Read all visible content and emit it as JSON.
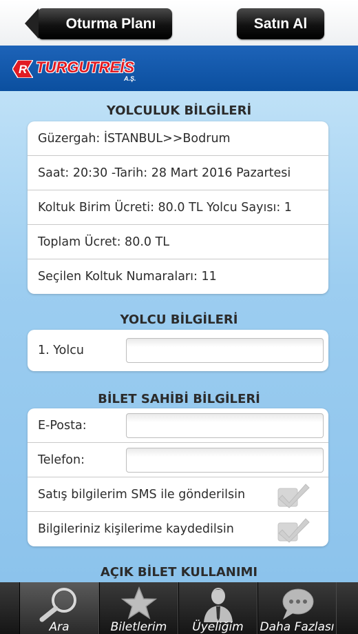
{
  "header": {
    "back_label": "Oturma Planı",
    "buy_label": "Satın Al"
  },
  "brand": {
    "logo_text": "TURGUTREİS",
    "logo_sub": "A.Ş."
  },
  "trip": {
    "title": "YOLCULUK BİLGİLERİ",
    "rows": [
      "Güzergah: İSTANBUL>>Bodrum",
      "Saat: 20:30 -Tarih: 28 Mart 2016 Pazartesi",
      "Koltuk Birim Ücreti: 80.0 TL  Yolcu Sayısı: 1",
      "Toplam Ücret: 80.0 TL",
      "Seçilen Koltuk Numaraları: 11"
    ]
  },
  "passenger": {
    "title": "YOLCU BİLGİLERİ",
    "label": "1. Yolcu",
    "value": ""
  },
  "owner": {
    "title": "BİLET SAHİBİ BİLGİLERİ",
    "email_label": "E-Posta:",
    "email_value": "",
    "phone_label": "Telefon:",
    "phone_value": "",
    "sms_label": "Satış bilgilerim SMS ile gönderilsin",
    "save_label": "Bilgileriniz kişilerime kaydedilsin"
  },
  "open_ticket": {
    "title": "AÇIK BİLET KULLANIMI"
  },
  "nav": {
    "tabs": [
      {
        "label": "Ara",
        "icon": "magnifier-icon"
      },
      {
        "label": "Biletlerim",
        "icon": "star-icon"
      },
      {
        "label": "Üyeliğim",
        "icon": "user-icon"
      },
      {
        "label": "Daha Fazlası",
        "icon": "chat-bubble-icon"
      }
    ],
    "active": "Ara"
  },
  "colors": {
    "brand_blue": "#0b4f9f",
    "brand_red": "#e21b22",
    "content_bg": "#9ccdf0",
    "nav_bg": "#1e1e1e"
  }
}
